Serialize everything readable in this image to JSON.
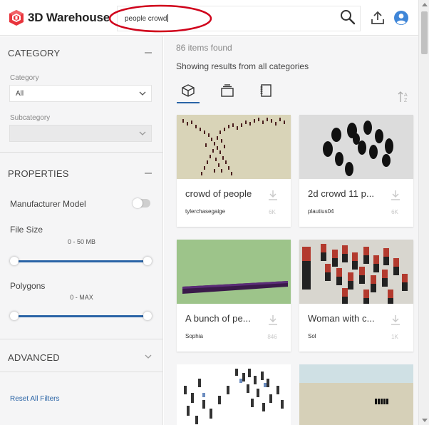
{
  "header": {
    "brand": "3D Warehouse",
    "search_value": "people crowd"
  },
  "sidebar": {
    "category_section": "CATEGORY",
    "category_label": "Category",
    "category_value": "All",
    "subcategory_label": "Subcategory",
    "subcategory_value": "",
    "properties_section": "PROPERTIES",
    "manufacturer_label": "Manufacturer Model",
    "manufacturer_on": false,
    "file_size_label": "File Size",
    "file_size_range": "0 - 50 MB",
    "polygons_label": "Polygons",
    "polygons_range": "0 - MAX",
    "advanced_section": "ADVANCED",
    "reset_label": "Reset All Filters"
  },
  "results": {
    "count_text": "86 items found",
    "scope_text": "Showing results from all categories",
    "tabs": [
      "models-tab",
      "collections-tab",
      "catalogs-tab"
    ],
    "active_tab": "models-tab"
  },
  "cards": [
    {
      "title": "crowd of people",
      "author": "tylerchasegaige",
      "downloads": "6K"
    },
    {
      "title": "2d crowd 11 p...",
      "author": "plautius04",
      "downloads": "6K"
    },
    {
      "title": "A bunch of pe...",
      "author": "Sophia",
      "downloads": "846"
    },
    {
      "title": "Woman with c...",
      "author": "Sol",
      "downloads": "1K"
    }
  ],
  "colors": {
    "accent": "#2a64a6",
    "annotation": "#d0021b",
    "logo": "#e8343c"
  }
}
